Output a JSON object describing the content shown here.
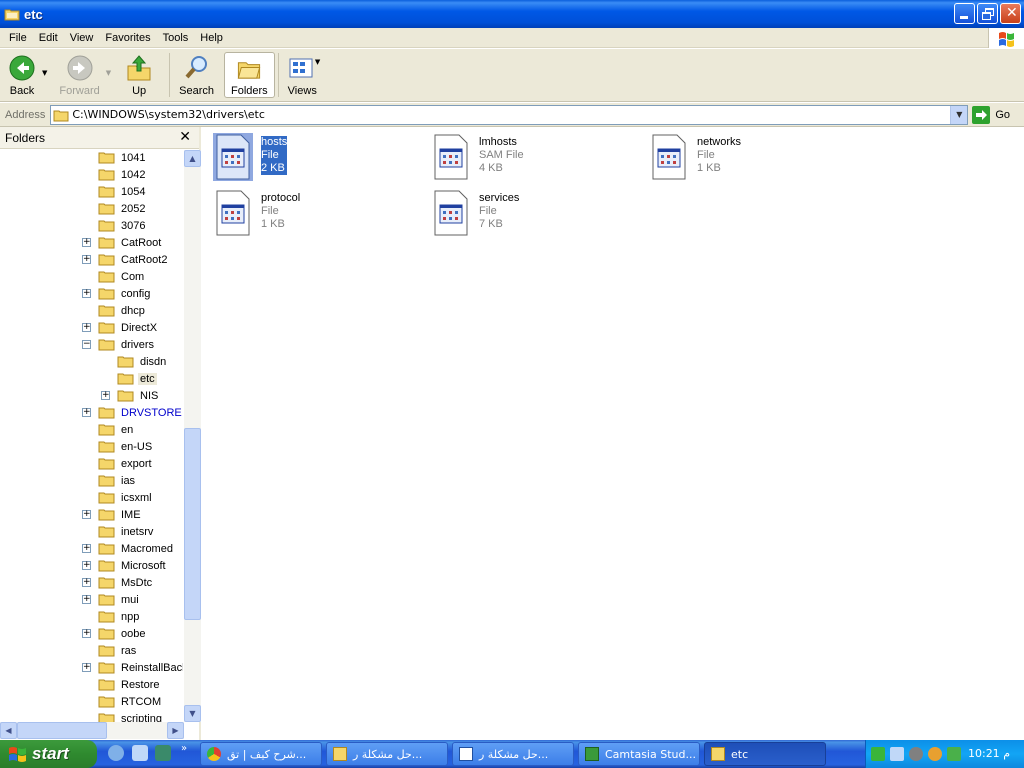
{
  "window": {
    "title": "etc"
  },
  "menu": [
    "File",
    "Edit",
    "View",
    "Favorites",
    "Tools",
    "Help"
  ],
  "toolbar": {
    "back": "Back",
    "forward": "Forward",
    "up": "Up",
    "search": "Search",
    "folders": "Folders",
    "views": "Views"
  },
  "address": {
    "label": "Address",
    "path": "C:\\WINDOWS\\system32\\drivers\\etc",
    "go": "Go"
  },
  "folders_pane": {
    "title": "Folders",
    "items": [
      "1041",
      "1042",
      "1054",
      "2052",
      "3076",
      "CatRoot",
      "CatRoot2",
      "Com",
      "config",
      "dhcp",
      "DirectX",
      "drivers",
      "disdn",
      "etc",
      "NIS",
      "DRVSTORE",
      "en",
      "en-US",
      "export",
      "ias",
      "icsxml",
      "IME",
      "inetsrv",
      "Macromed",
      "Microsoft",
      "MsDtc",
      "mui",
      "npp",
      "oobe",
      "ras",
      "ReinstallBacku",
      "Restore",
      "RTCOM",
      "scripting"
    ]
  },
  "files": [
    {
      "name": "hosts",
      "type": "File",
      "size": "2 KB"
    },
    {
      "name": "lmhosts",
      "type": "SAM File",
      "size": "4 KB"
    },
    {
      "name": "networks",
      "type": "File",
      "size": "1 KB"
    },
    {
      "name": "protocol",
      "type": "File",
      "size": "1 KB"
    },
    {
      "name": "services",
      "type": "File",
      "size": "7 KB"
    }
  ],
  "taskbar": {
    "start": "start",
    "buttons": [
      "شرح كيف | تق...",
      "حل مشكلة ر...",
      "حل مشكلة ر...",
      "Camtasia Stud...",
      "etc"
    ],
    "clock": "10:21 م"
  },
  "colors": {
    "selection": "#316ac5",
    "titlebar": "#0058e6",
    "start": "#2f8a2f"
  }
}
